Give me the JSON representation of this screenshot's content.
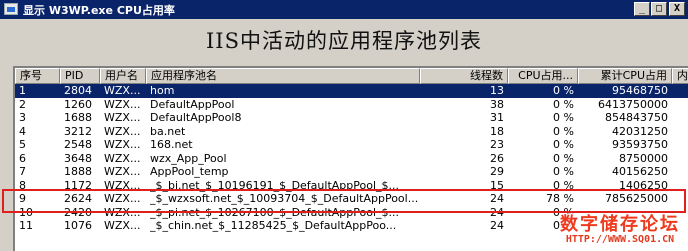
{
  "window": {
    "title": "显示 W3WP.exe CPU占用率",
    "minimize_glyph": "_",
    "maximize_glyph": "□",
    "close_glyph": "X"
  },
  "heading": "IIS中活动的应用程序池列表",
  "columns": [
    "序号",
    "PID",
    "用户名",
    "应用程序池名",
    "线程数",
    "CPU占用...",
    "累计CPU占用",
    "内"
  ],
  "rows": [
    {
      "idx": "1",
      "pid": "2804",
      "user": "WZX...",
      "pool": "hom",
      "threads": "13",
      "cpu": "0 %",
      "total": "95468750",
      "selected": true
    },
    {
      "idx": "2",
      "pid": "1260",
      "user": "WZX...",
      "pool": "DefaultAppPool",
      "threads": "38",
      "cpu": "0 %",
      "total": "6413750000"
    },
    {
      "idx": "3",
      "pid": "1688",
      "user": "WZX...",
      "pool": "DefaultAppPool8",
      "threads": "31",
      "cpu": "0 %",
      "total": "854843750"
    },
    {
      "idx": "4",
      "pid": "3212",
      "user": "WZX...",
      "pool": "ba.net",
      "threads": "18",
      "cpu": "0 %",
      "total": "42031250"
    },
    {
      "idx": "5",
      "pid": "2548",
      "user": "WZX...",
      "pool": "168.net",
      "threads": "23",
      "cpu": "0 %",
      "total": "93593750"
    },
    {
      "idx": "6",
      "pid": "3648",
      "user": "WZX...",
      "pool": "wzx_App_Pool",
      "threads": "26",
      "cpu": "0 %",
      "total": "8750000"
    },
    {
      "idx": "7",
      "pid": "1888",
      "user": "WZX...",
      "pool": "AppPool_temp",
      "threads": "29",
      "cpu": "0 %",
      "total": "40156250"
    },
    {
      "idx": "8",
      "pid": "1172",
      "user": "WZX...",
      "pool": "_$_bi.net_$_10196191_$_DefaultAppPool_$...",
      "threads": "15",
      "cpu": "0 %",
      "total": "1406250"
    },
    {
      "idx": "9",
      "pid": "2624",
      "user": "WZX...",
      "pool": "_$_wzxsoft.net_$_10093704_$_DefaultAppPool...",
      "threads": "24",
      "cpu": "78 %",
      "total": "785625000"
    },
    {
      "idx": "10",
      "pid": "2420",
      "user": "WZX...",
      "pool": "_$_pi.net_$_10267100_$_DefaultAppPool_$...",
      "threads": "24",
      "cpu": "0 %",
      "total": ""
    },
    {
      "idx": "11",
      "pid": "1076",
      "user": "WZX...",
      "pool": "_$_chin.net_$_11285425_$_DefaultAppPoo...",
      "threads": "24",
      "cpu": "0 %",
      "total": ""
    }
  ],
  "watermark": {
    "text": "数字储存论坛",
    "url": "HTTP://WWW.SQ01.CN"
  }
}
